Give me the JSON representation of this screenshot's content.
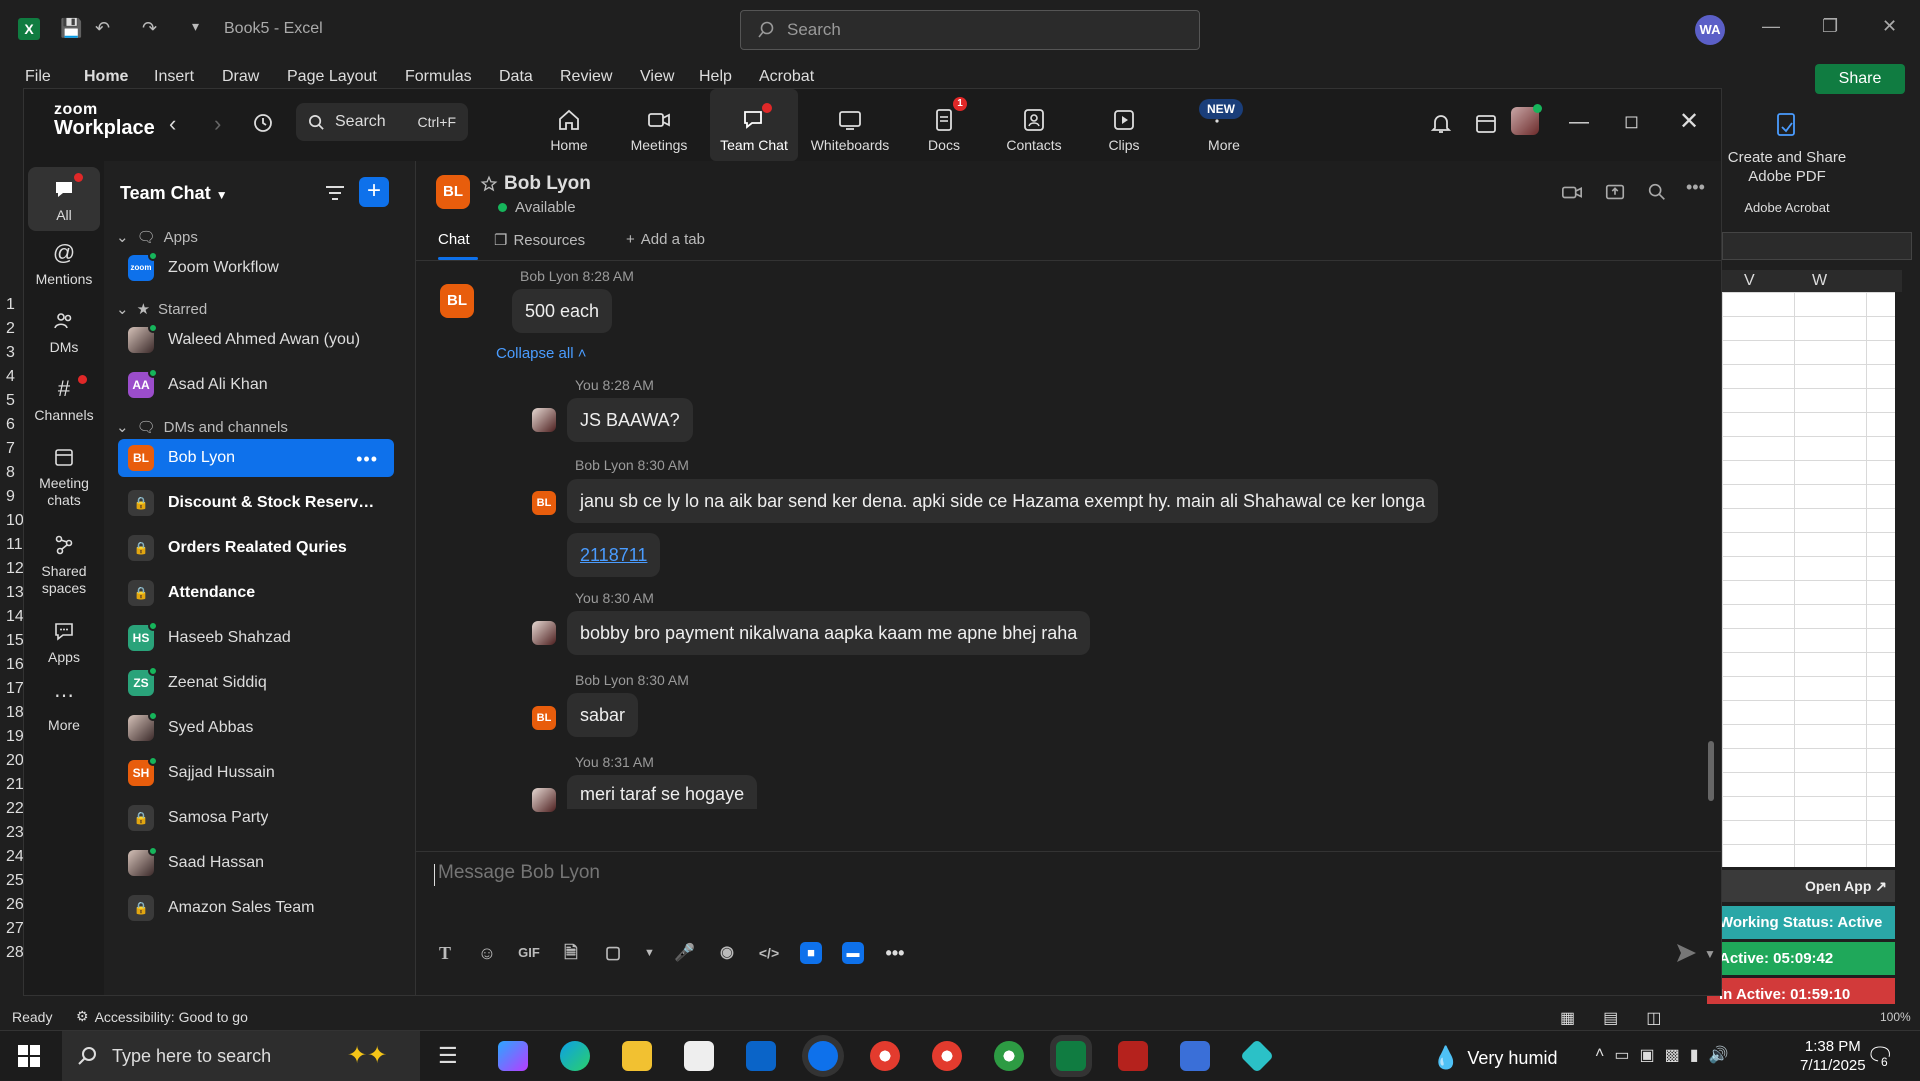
{
  "excel": {
    "logo": "X",
    "title": "Book5  -  Excel",
    "search_placeholder": "Search",
    "avatar": "WA",
    "menu": [
      "File",
      "Home",
      "Insert",
      "Draw",
      "Page Layout",
      "Formulas",
      "Data",
      "Review",
      "View",
      "Help",
      "Acrobat"
    ],
    "share": "Share",
    "adobe_button": "Create and Share Adobe PDF",
    "adobe_group": "Adobe Acrobat",
    "columns": [
      "V",
      "W"
    ],
    "row_numbers": [
      "1",
      "2",
      "3",
      "4",
      "5",
      "6",
      "7",
      "8",
      "9",
      "10",
      "11",
      "12",
      "13",
      "14",
      "15",
      "16",
      "17",
      "18",
      "19",
      "20",
      "21",
      "22",
      "23",
      "24",
      "25",
      "26",
      "27",
      "28"
    ],
    "open_app": "Open App ↗",
    "working_status": "Working Status: Active",
    "active_time": "Active: 05:09:42",
    "inactive_time": "In Active: 01:59:10",
    "status_ready": "Ready",
    "status_accessibility": "Accessibility: Good to go",
    "zoom_level": "100%"
  },
  "zoom": {
    "logo_top": "zoom",
    "logo_bottom": "Workplace",
    "search_label": "Search",
    "search_shortcut": "Ctrl+F",
    "tabs": [
      {
        "label": "Home",
        "icon": "home-icon"
      },
      {
        "label": "Meetings",
        "icon": "video-camera-icon"
      },
      {
        "label": "Team Chat",
        "icon": "chat-icon"
      },
      {
        "label": "Whiteboards",
        "icon": "whiteboard-icon"
      },
      {
        "label": "Docs",
        "icon": "docs-icon",
        "badge": "1"
      },
      {
        "label": "Contacts",
        "icon": "contacts-icon"
      },
      {
        "label": "Clips",
        "icon": "clips-icon"
      },
      {
        "label": "More",
        "icon": "more-icon"
      }
    ],
    "new_badge": "NEW",
    "rail": [
      {
        "label": "All",
        "icon": "chat-bubble-icon"
      },
      {
        "label": "Mentions",
        "icon": "at-icon"
      },
      {
        "label": "DMs",
        "icon": "people-icon"
      },
      {
        "label": "Channels",
        "icon": "hash-icon"
      },
      {
        "label": "Meeting chats",
        "icon": "calendar-icon"
      },
      {
        "label": "Shared spaces",
        "icon": "shared-spaces-icon"
      },
      {
        "label": "Apps",
        "icon": "apps-icon"
      },
      {
        "label": "More",
        "icon": "more-dots-icon"
      }
    ],
    "list": {
      "title": "Team Chat",
      "sections": {
        "apps": "Apps",
        "starred": "Starred",
        "dms": "DMs and channels"
      },
      "apps_items": [
        {
          "label": "Zoom Workflow",
          "avatar": "zoom"
        }
      ],
      "starred_items": [
        {
          "label": "Waleed Ahmed Awan (you)",
          "avatar": ""
        },
        {
          "label": "Asad Ali Khan",
          "avatar": "AA"
        }
      ],
      "dm_items": [
        {
          "label": "Bob Lyon",
          "avatar": "BL"
        },
        {
          "label": "Discount & Stock Reserva...",
          "avatar": ""
        },
        {
          "label": "Orders Realated Quries",
          "avatar": ""
        },
        {
          "label": "Attendance",
          "avatar": ""
        },
        {
          "label": "Haseeb Shahzad",
          "avatar": "HS"
        },
        {
          "label": "Zeenat Siddiq",
          "avatar": "ZS"
        },
        {
          "label": "Syed Abbas",
          "avatar": ""
        },
        {
          "label": "Sajjad Hussain",
          "avatar": "SH"
        },
        {
          "label": "Samosa Party",
          "avatar": ""
        },
        {
          "label": "Saad Hassan",
          "avatar": ""
        },
        {
          "label": "Amazon Sales Team",
          "avatar": ""
        }
      ]
    },
    "conversation": {
      "avatar": "BL",
      "name": "Bob Lyon",
      "status": "Available",
      "tabs": {
        "chat": "Chat",
        "resources": "Resources",
        "add": "Add a tab"
      },
      "collapse_all": "Collapse all",
      "messages": [
        {
          "meta": "Bob Lyon 8:28 AM",
          "text": "500 each",
          "avatar": "BL"
        },
        {
          "meta": "You 8:28 AM",
          "text": "JS BAAWA?",
          "avatar": ""
        },
        {
          "meta": "Bob Lyon 8:30 AM",
          "text": "janu sb ce ly lo na aik bar send ker dena. apki side ce Hazama exempt hy. main ali Shahawal ce ker longa",
          "avatar": "BL"
        },
        {
          "meta": "",
          "text": "2118711",
          "avatar": ""
        },
        {
          "meta": "You 8:30 AM",
          "text": "bobby bro payment nikalwana aapka kaam me apne bhej raha",
          "avatar": ""
        },
        {
          "meta": "Bob Lyon 8:30 AM",
          "text": "sabar",
          "avatar": "BL"
        },
        {
          "meta": "You 8:31 AM",
          "text": "meri taraf se hogaye",
          "avatar": ""
        }
      ],
      "composer_placeholder": "Message Bob Lyon",
      "gif_label": "GIF"
    }
  },
  "taskbar": {
    "search_placeholder": "Type here to search",
    "weather": "Very humid",
    "time": "1:38 PM",
    "date": "7/11/2025",
    "notifications": "6"
  },
  "colors": {
    "zoom_blue": "#0e71eb",
    "excel_green": "#107c41",
    "status_active_green": "#1fa85a",
    "status_working_teal": "#2aa7a7",
    "status_inactive_red": "#d23a3a"
  }
}
